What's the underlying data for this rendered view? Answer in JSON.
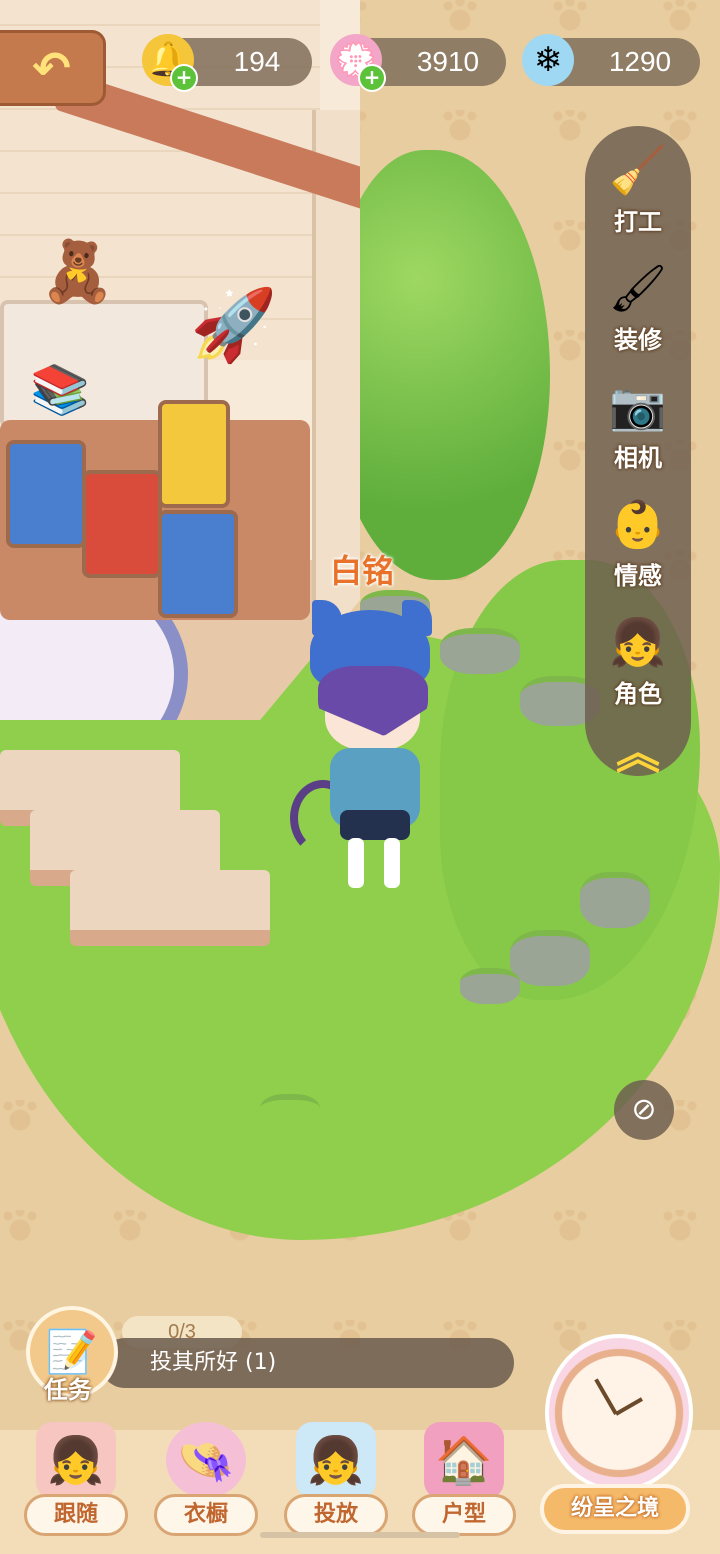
{
  "currencies": [
    {
      "name": "bell",
      "icon": "bell-icon",
      "value": "194",
      "has_add": true
    },
    {
      "name": "pink-gem",
      "icon": "pink-gem-icon",
      "value": "3910",
      "has_add": true
    },
    {
      "name": "blue-crystal",
      "icon": "blue-crystal-icon",
      "value": "1290",
      "has_add": false
    }
  ],
  "side_menu": {
    "items": [
      {
        "label": "打工",
        "icon": "duster-icon"
      },
      {
        "label": "装修",
        "icon": "paint-roller-icon"
      },
      {
        "label": "相机",
        "icon": "camera-icon"
      },
      {
        "label": "情感",
        "icon": "emotion-icon"
      },
      {
        "label": "角色",
        "icon": "character-avatar-icon"
      }
    ]
  },
  "character": {
    "name": "白铭"
  },
  "task": {
    "label": "任务",
    "progress": "0/3",
    "title": "投其所好 (1)"
  },
  "bottom_nav": {
    "items": [
      {
        "label": "跟随",
        "icon": "follow-avatar-icon"
      },
      {
        "label": "衣橱",
        "icon": "wardrobe-hat-icon"
      },
      {
        "label": "投放",
        "icon": "place-avatar-icon"
      },
      {
        "label": "户型",
        "icon": "floorplan-icon"
      }
    ],
    "special": {
      "label": "纷呈之境",
      "icon": "clock-icon"
    }
  },
  "colors": {
    "accent": "#e9722a",
    "panel": "#6e5f50",
    "add_green": "#5cc23a",
    "gold": "#ffd43a"
  }
}
